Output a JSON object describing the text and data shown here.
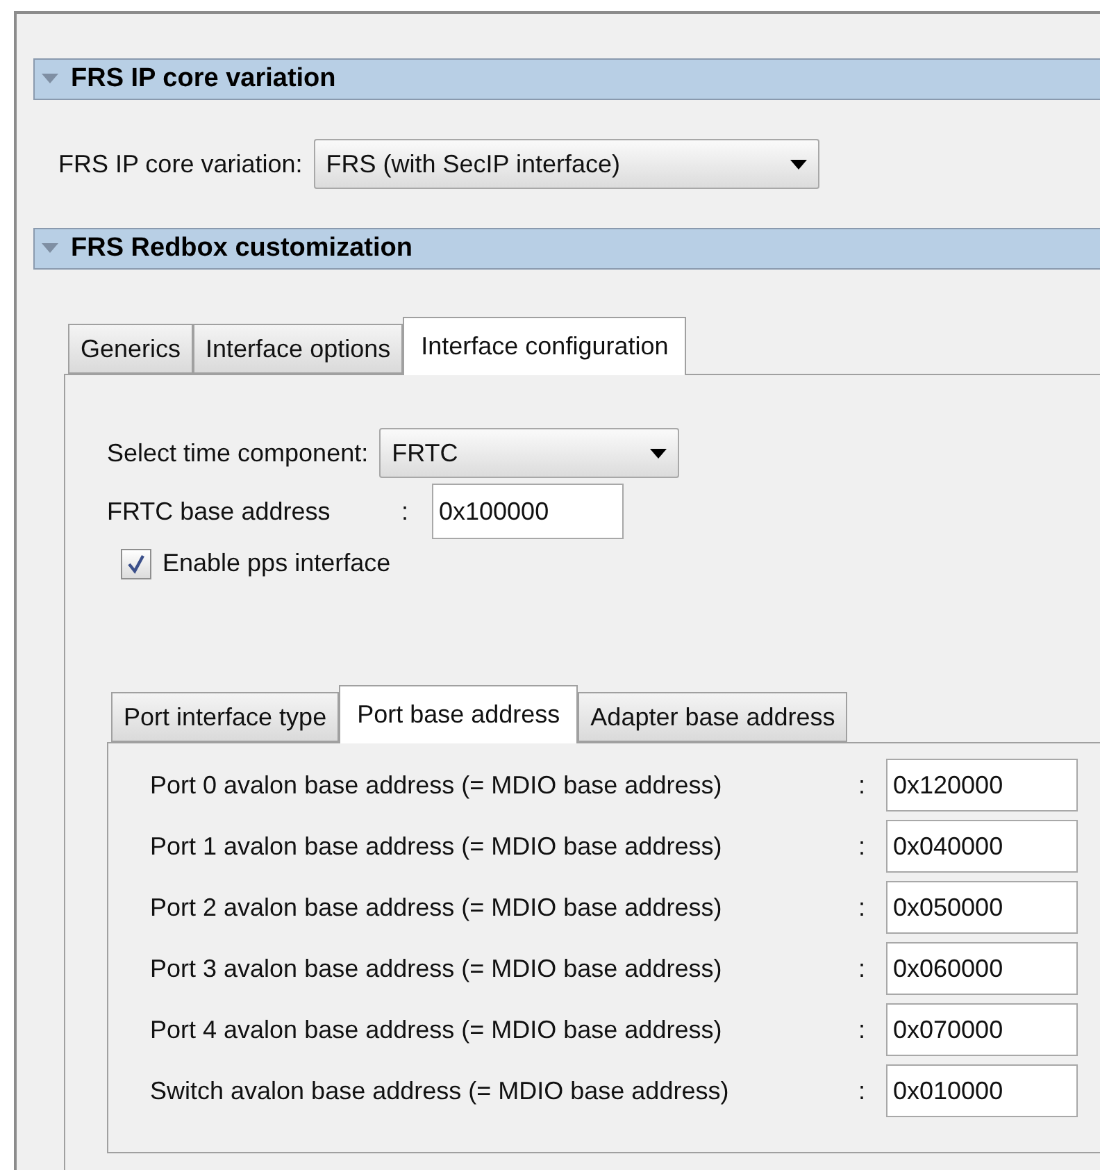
{
  "ip_core_section": {
    "title": "FRS IP core variation",
    "expanded": true,
    "field": {
      "label": "FRS IP core variation:",
      "value": "FRS (with SecIP interface)"
    }
  },
  "redbox_section": {
    "title": "FRS Redbox customization",
    "expanded": true,
    "tabs": [
      {
        "label": "Generics",
        "selected": false
      },
      {
        "label": "Interface options",
        "selected": false
      },
      {
        "label": "Interface configuration",
        "selected": true
      }
    ],
    "time_component": {
      "label": "Select time component:",
      "value": "FRTC"
    },
    "frtc_address": {
      "label": "FRTC base address",
      "colon": ":",
      "value": "0x100000"
    },
    "pps_checkbox": {
      "label": "Enable pps interface",
      "checked": true
    },
    "port_tabs": [
      {
        "label": "Port interface type",
        "selected": false
      },
      {
        "label": "Port base address",
        "selected": true
      },
      {
        "label": "Adapter base address",
        "selected": false
      }
    ],
    "port_rows": [
      {
        "label": "Port 0 avalon base address (= MDIO base address)",
        "colon": ":",
        "value": "0x120000"
      },
      {
        "label": "Port 1 avalon base address (= MDIO base address)",
        "colon": ":",
        "value": "0x040000"
      },
      {
        "label": "Port 2 avalon base address (= MDIO base address)",
        "colon": ":",
        "value": "0x050000"
      },
      {
        "label": "Port 3 avalon base address (= MDIO base address)",
        "colon": ":",
        "value": "0x060000"
      },
      {
        "label": "Port 4 avalon base address (= MDIO base address)",
        "colon": ":",
        "value": "0x070000"
      },
      {
        "label": "Switch avalon base address (= MDIO base address)",
        "colon": ":",
        "value": "0x010000"
      }
    ]
  }
}
